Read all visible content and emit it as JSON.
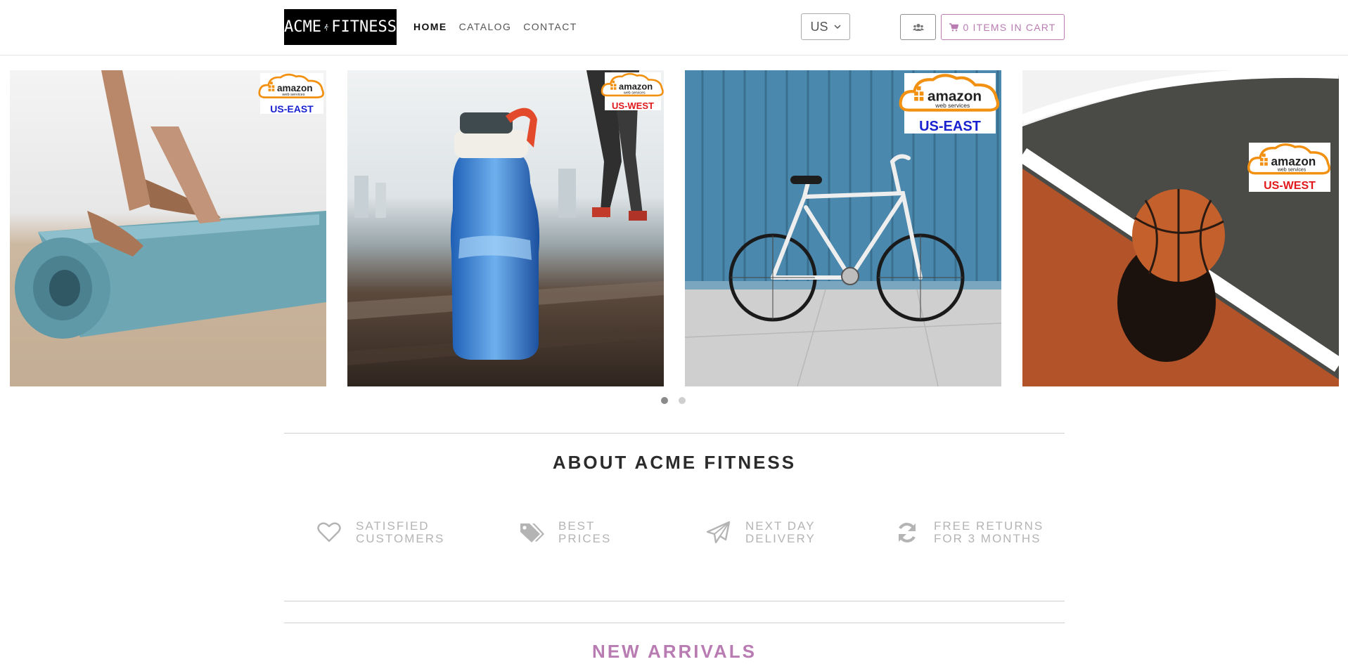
{
  "header": {
    "logo": {
      "left_text": "ACME",
      "right_text": "FITNESS"
    },
    "nav": [
      {
        "label": "HOME",
        "active": true
      },
      {
        "label": "CATALOG",
        "active": false
      },
      {
        "label": "CONTACT",
        "active": false
      }
    ],
    "region_select": {
      "value": "US"
    },
    "user_button_icon": "users-icon",
    "cart": {
      "icon": "cart-icon",
      "label": "0 ITEMS IN CART"
    }
  },
  "carousel": {
    "slides": [
      {
        "name": "yoga-mat",
        "badge": {
          "brand": "amazon",
          "sub": "web services",
          "region": "US-EAST"
        }
      },
      {
        "name": "water-bottle",
        "badge": {
          "brand": "amazon",
          "sub": "web services",
          "region": "US-WEST"
        }
      },
      {
        "name": "bicycle",
        "badge": {
          "brand": "amazon",
          "sub": "web services",
          "region": "US-EAST"
        }
      },
      {
        "name": "basketball",
        "badge": {
          "brand": "amazon",
          "sub": "web services",
          "region": "US-WEST"
        }
      }
    ],
    "dots": {
      "count": 2,
      "active_index": 0
    }
  },
  "about": {
    "title": "ABOUT ACME FITNESS",
    "features": [
      {
        "icon": "heart-icon",
        "line1": "SATISFIED",
        "line2": "CUSTOMERS"
      },
      {
        "icon": "tags-icon",
        "line1": "BEST",
        "line2": "PRICES"
      },
      {
        "icon": "paper-plane-icon",
        "line1": "NEXT DAY",
        "line2": "DELIVERY"
      },
      {
        "icon": "refresh-icon",
        "line1": "FREE RETURNS",
        "line2": "FOR 3 MONTHS"
      }
    ]
  },
  "new_arrivals": {
    "title": "NEW ARRIVALS"
  },
  "colors": {
    "accent": "#b97cb2",
    "aws_orange": "#f29111",
    "east_blue": "#1a22d0",
    "west_red": "#e1181b",
    "feature_gray": "#b4b4b4"
  }
}
